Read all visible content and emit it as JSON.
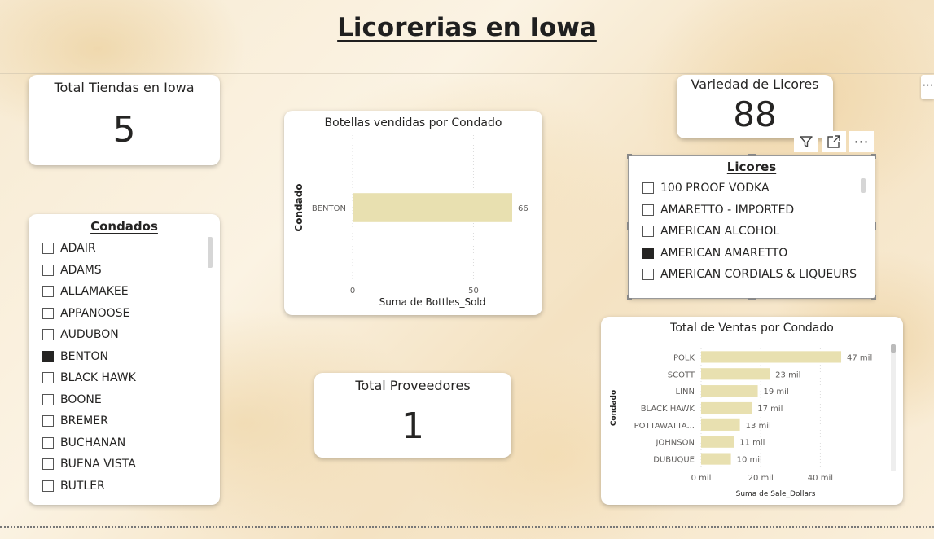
{
  "report": {
    "title": "Licorerias en Iowa"
  },
  "kpi_tiendas": {
    "label": "Total Tiendas en Iowa",
    "value": "5"
  },
  "kpi_variedad": {
    "label": "Variedad de Licores",
    "value": "88"
  },
  "kpi_proveedores": {
    "label": "Total Proveedores",
    "value": "1"
  },
  "condados_slicer": {
    "title": "Condados",
    "items": [
      {
        "label": "ADAIR",
        "checked": false
      },
      {
        "label": "ADAMS",
        "checked": false
      },
      {
        "label": "ALLAMAKEE",
        "checked": false
      },
      {
        "label": "APPANOOSE",
        "checked": false
      },
      {
        "label": "AUDUBON",
        "checked": false
      },
      {
        "label": "BENTON",
        "checked": true
      },
      {
        "label": "BLACK HAWK",
        "checked": false
      },
      {
        "label": "BOONE",
        "checked": false
      },
      {
        "label": "BREMER",
        "checked": false
      },
      {
        "label": "BUCHANAN",
        "checked": false
      },
      {
        "label": "BUENA VISTA",
        "checked": false
      },
      {
        "label": "BUTLER",
        "checked": false
      }
    ]
  },
  "licores_slicer": {
    "title": "Licores",
    "items": [
      {
        "label": "100 PROOF VODKA",
        "checked": false
      },
      {
        "label": "AMARETTO - IMPORTED",
        "checked": false
      },
      {
        "label": "AMERICAN ALCOHOL",
        "checked": false
      },
      {
        "label": "AMERICAN AMARETTO",
        "checked": true
      },
      {
        "label": "AMERICAN CORDIALS & LIQUEURS",
        "checked": false
      }
    ],
    "toolbar": {
      "filter_icon": "filter-icon",
      "focus_icon": "focus-mode-icon",
      "more_icon": "more-options-icon",
      "more_label": "⋯"
    }
  },
  "edge_more": {
    "label": "⋯"
  },
  "chart_data": [
    {
      "type": "bar",
      "orientation": "horizontal",
      "title": "Botellas vendidas por Condado",
      "xlabel": "Suma de Bottles_Sold",
      "ylabel": "Condado",
      "categories": [
        "BENTON"
      ],
      "values": [
        66
      ],
      "value_labels": [
        "66"
      ],
      "xlim": [
        0,
        66
      ],
      "xticks": [
        0,
        50
      ],
      "xtick_labels": [
        "0",
        "50"
      ],
      "grid": true,
      "bar_color": "#e8e0b0"
    },
    {
      "type": "bar",
      "orientation": "horizontal",
      "title": "Total de Ventas por Condado",
      "xlabel": "Suma de Sale_Dollars",
      "ylabel": "Condado",
      "categories": [
        "POLK",
        "SCOTT",
        "LINN",
        "BLACK HAWK",
        "POTTAWATTA...",
        "JOHNSON",
        "DUBUQUE"
      ],
      "values": [
        47000,
        23000,
        19000,
        17000,
        13000,
        11000,
        10000
      ],
      "value_labels": [
        "47 mil",
        "23 mil",
        "19 mil",
        "17 mil",
        "13 mil",
        "11 mil",
        "10 mil"
      ],
      "xlim": [
        0,
        50000
      ],
      "xticks": [
        0,
        20000,
        40000
      ],
      "xtick_labels": [
        "0 mil",
        "20 mil",
        "40 mil"
      ],
      "grid": true,
      "bar_color": "#e8e0b0"
    }
  ]
}
